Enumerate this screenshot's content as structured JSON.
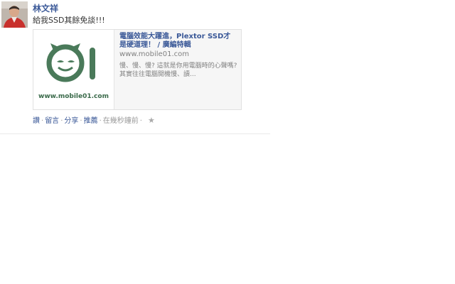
{
  "post": {
    "author": "林文祥",
    "message": "給我SSD其餘免談!!!",
    "share": {
      "title": "電腦效能大躍進，Plextor SSD才是硬道理！ / 廣編特輯",
      "url": "www.mobile01.com",
      "description": "慢、慢、慢? 這就是你用電腦時的心聲嗎? 其實往往電腦開機慢、讀...",
      "logo_text": "www.mobile01.com",
      "logo_color": "#4a7a5a"
    },
    "actions": {
      "like": "讚",
      "comment": "留言",
      "share": "分享",
      "recommend": "推薦",
      "timestamp": "在幾秒鐘前",
      "star_icon": "star-icon"
    }
  },
  "colors": {
    "link": "#3b5998",
    "muted": "#999999"
  }
}
